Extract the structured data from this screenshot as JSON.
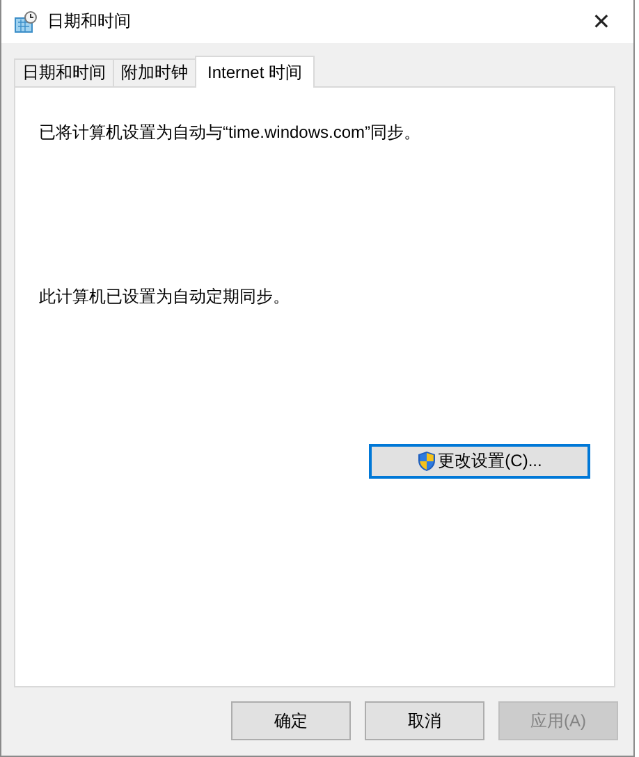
{
  "window": {
    "title": "日期和时间",
    "close": "✕"
  },
  "tabs": [
    {
      "label": "日期和时间",
      "selected": false
    },
    {
      "label": "附加时钟",
      "selected": false
    },
    {
      "label": "Internet 时间",
      "selected": true
    }
  ],
  "panel": {
    "sync_text": "已将计算机设置为自动与“time.windows.com”同步。",
    "status_text": "此计算机已设置为自动定期同步。",
    "change_button": {
      "label": "更改设置(C)...",
      "focused": true
    }
  },
  "buttons": [
    {
      "label": "确定",
      "disabled": false
    },
    {
      "label": "取消",
      "disabled": false
    },
    {
      "label": "应用(A)",
      "disabled": true
    }
  ]
}
